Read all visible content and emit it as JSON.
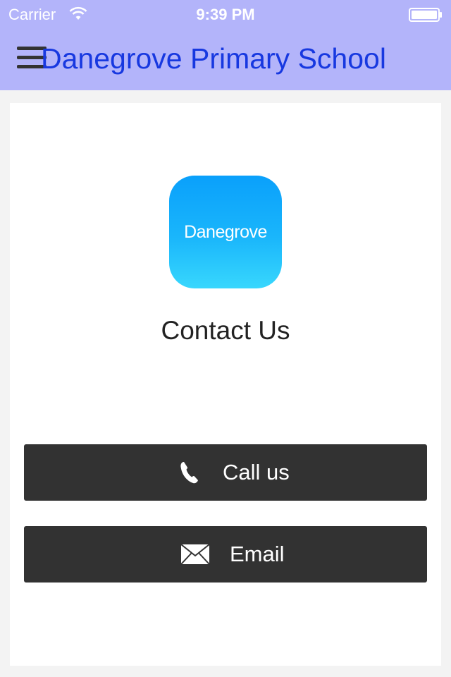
{
  "status_bar": {
    "carrier": "Carrier",
    "time": "9:39 PM",
    "wifi_icon": "wifi-icon",
    "battery_icon": "battery-icon"
  },
  "header": {
    "title": "Danegrove Primary School",
    "menu_icon": "hamburger-menu-icon",
    "background_color": "#b3b4fa",
    "title_color": "#1738e0"
  },
  "logo": {
    "text": "Danegrove",
    "gradient_top": "#0aa0fb",
    "gradient_bottom": "#38d7fd"
  },
  "page": {
    "title": "Contact Us"
  },
  "actions": [
    {
      "label": "Call us",
      "icon": "phone-icon"
    },
    {
      "label": "Email",
      "icon": "mail-icon"
    }
  ],
  "colors": {
    "button_background": "#323232",
    "button_text": "#ffffff"
  }
}
